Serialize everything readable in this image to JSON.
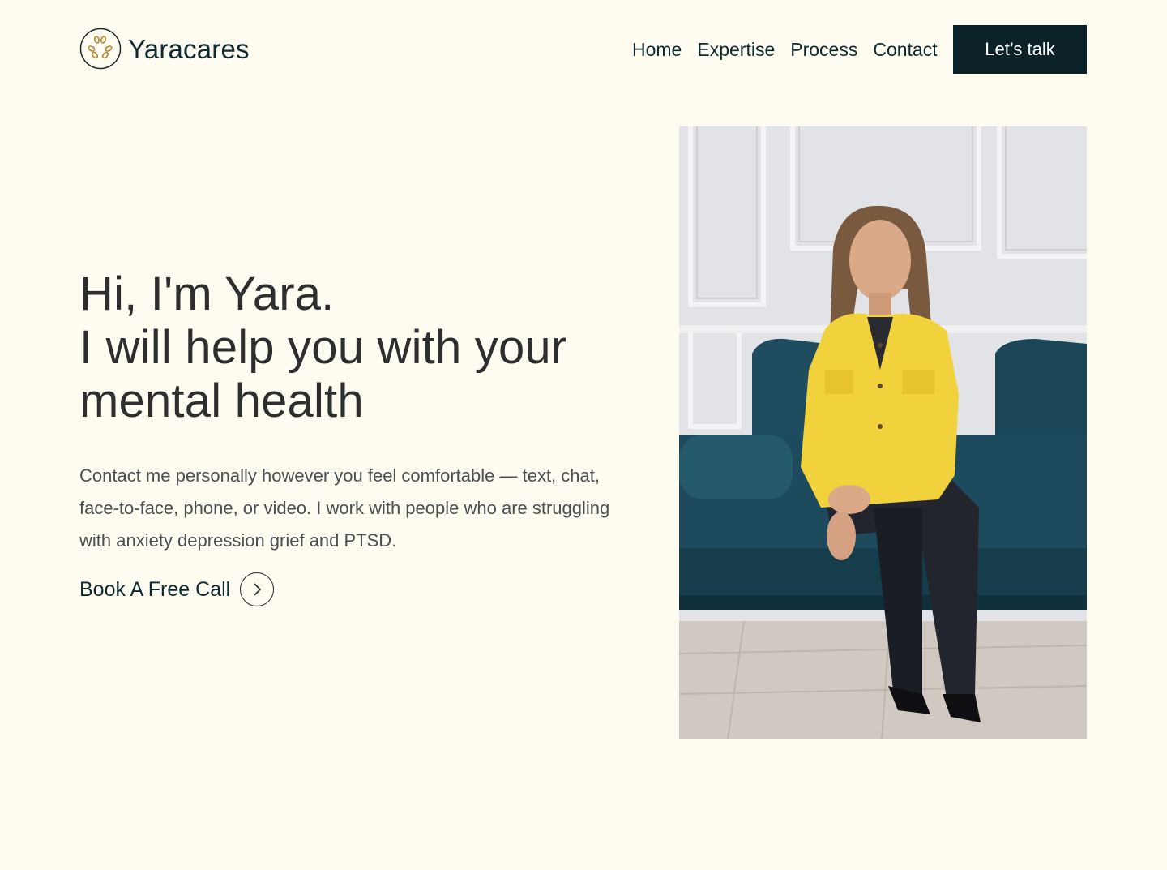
{
  "brand": {
    "name": "Yaracares",
    "accent": "#b8862f"
  },
  "nav": {
    "items": [
      {
        "label": "Home"
      },
      {
        "label": "Expertise"
      },
      {
        "label": "Process"
      },
      {
        "label": "Contact"
      }
    ],
    "cta_label": "Let’s talk"
  },
  "hero": {
    "title_lines": [
      "Hi, I'm Yara.",
      "I will help you with your",
      "mental health"
    ],
    "description": "Contact me personally however you feel comfortable — text, chat, face-to-face, phone, or video. I work with people who are struggling with anxiety depression grief and PTSD.",
    "book_label": "Book A Free Call",
    "book_icon": "chevron-right-icon"
  },
  "colors": {
    "background": "#fefcf0",
    "dark": "#0a2228",
    "jacket": "#f2d23c",
    "sofa": "#1d4a5c"
  }
}
